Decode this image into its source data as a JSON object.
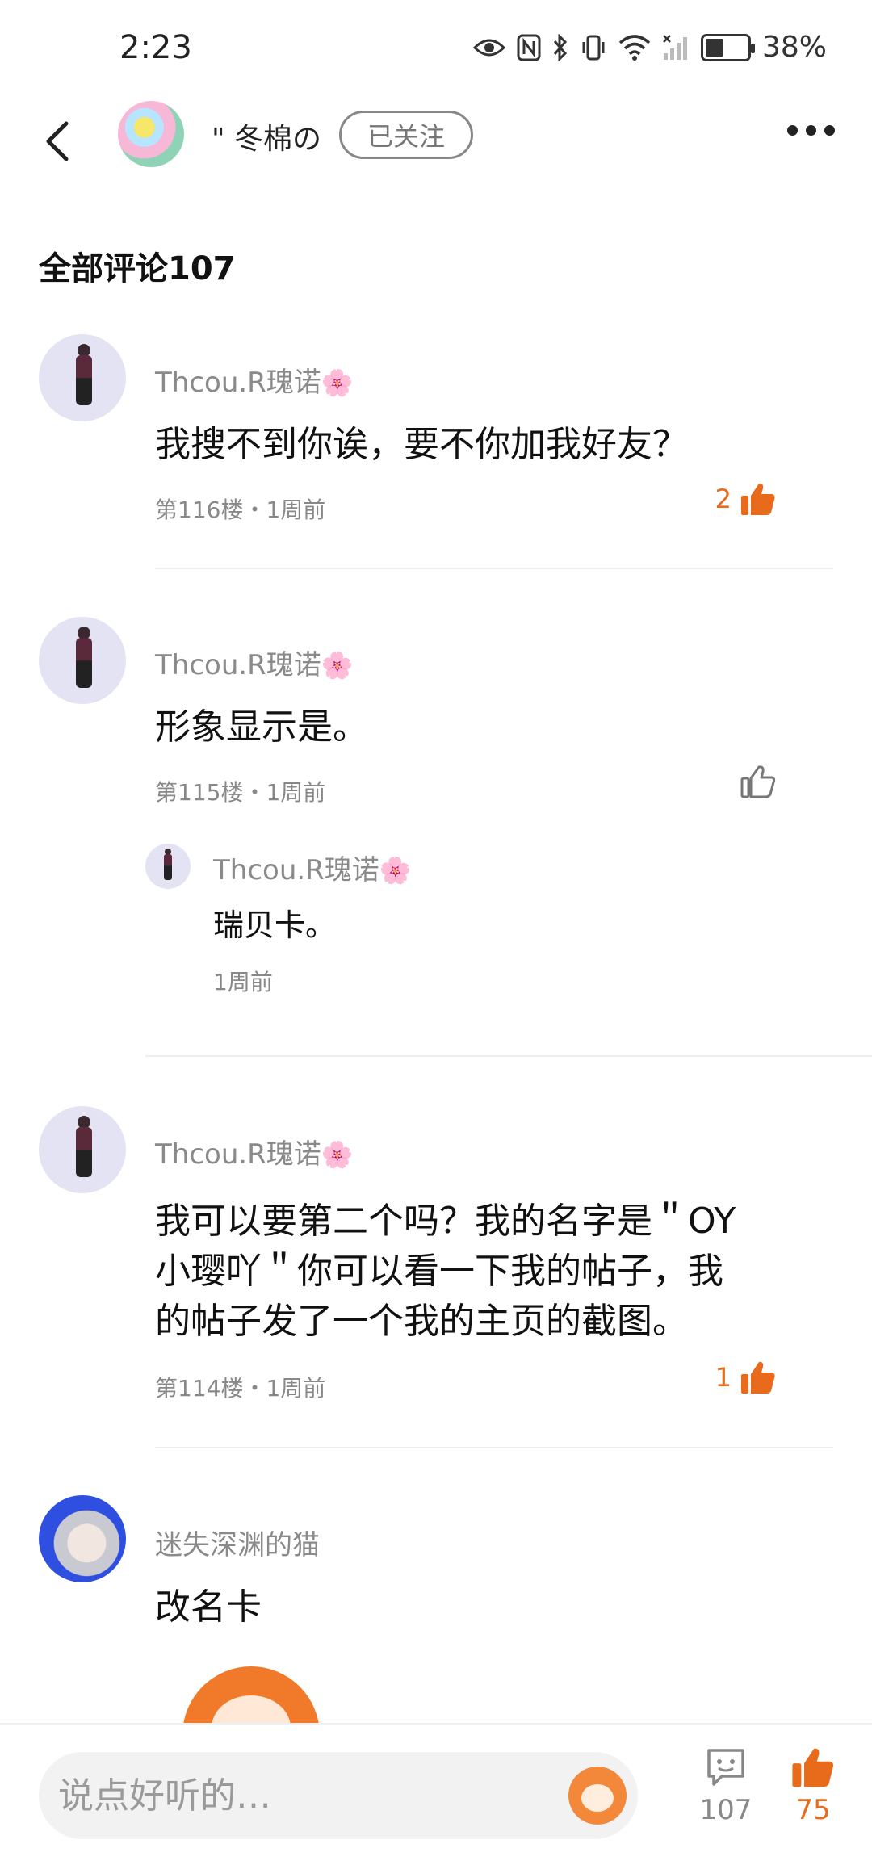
{
  "status_bar": {
    "time": "2:23",
    "battery_percent": "38%",
    "battery_level": 0.38
  },
  "header": {
    "author_name": "\" 冬棉の",
    "follow_label": "已关注"
  },
  "comments_section": {
    "title": "全部评论107"
  },
  "comments": [
    {
      "username": "Thcou.R瑰诺",
      "text": "我搜不到你诶，要不你加我好友？",
      "floor": "第116楼",
      "time": "1周前",
      "likes": "2",
      "liked": true
    },
    {
      "username": "Thcou.R瑰诺",
      "text": "形象显示是。",
      "floor": "第115楼",
      "time": "1周前",
      "likes": "",
      "liked": false,
      "reply": {
        "username": "Thcou.R瑰诺",
        "text": "瑞贝卡。",
        "time": "1周前"
      }
    },
    {
      "username": "Thcou.R瑰诺",
      "text_lines": [
        "我可以要第二个吗？我的名字是＂OY",
        "小璎吖＂你可以看一下我的帖子，我",
        "的帖子发了一个我的主页的截图。"
      ],
      "floor": "第114楼",
      "time": "1周前",
      "likes": "1",
      "liked": true
    },
    {
      "username": "迷失深渊的猫",
      "text": "改名卡"
    }
  ],
  "separator": "・",
  "bottom_bar": {
    "input_placeholder": "说点好听的…",
    "comment_count": "107",
    "like_count": "75"
  },
  "colors": {
    "accent": "#e86a1b",
    "muted_text": "#8a8a8a"
  }
}
